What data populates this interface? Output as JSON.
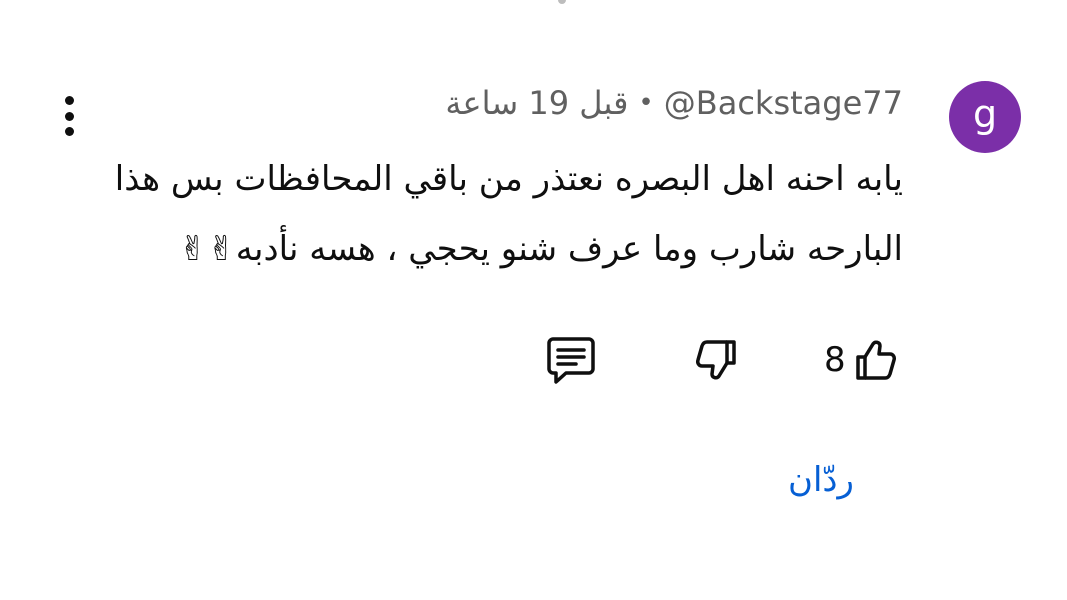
{
  "comment": {
    "avatar_letter": "g",
    "avatar_color": "#7b2fa8",
    "author": "@Backstage77",
    "separator": "•",
    "time": "قبل 19 ساعة",
    "text_line_1": "يابه احنه اهل البصره نعتذر من باقي المحافظات بس هذا",
    "text_line_2": "البارحه شارب وما عرف شنو يحجي ، هسه نأدبه",
    "emoji": "✌✌",
    "like_count": "8",
    "replies_label": "ردّان",
    "replies_color": "#065fd4"
  },
  "icons": {
    "more": "more-vertical-icon",
    "like": "thumb-up-icon",
    "dislike": "thumb-down-icon",
    "reply": "comment-icon"
  }
}
